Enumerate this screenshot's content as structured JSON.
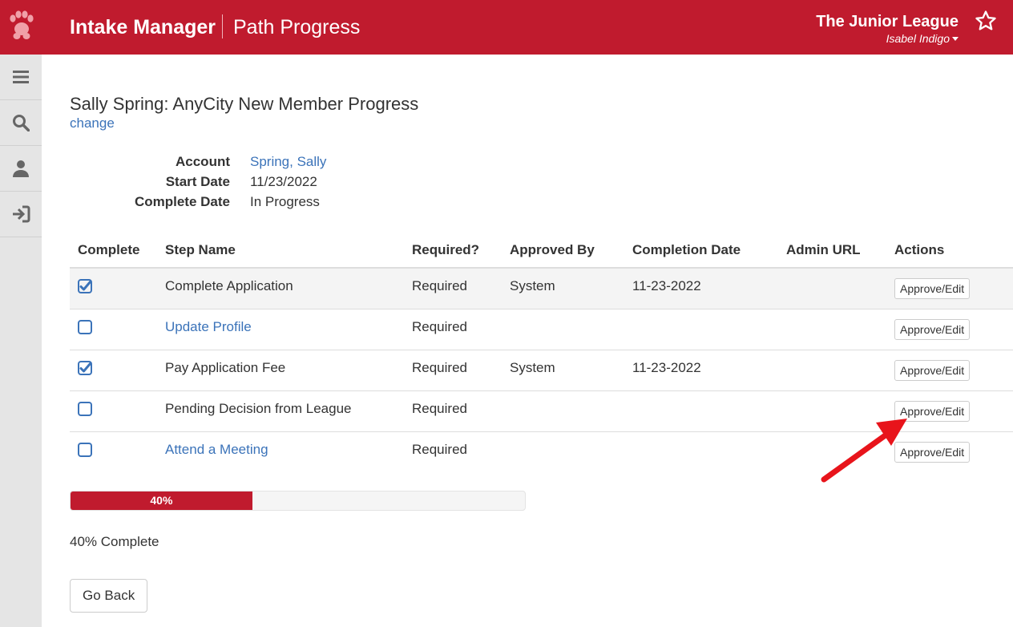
{
  "header": {
    "app_name": "Intake Manager",
    "section": "Path Progress",
    "organization": "The Junior League",
    "user_name": "Isabel Indigo"
  },
  "sidebar": {
    "items": [
      {
        "icon": "menu-icon"
      },
      {
        "icon": "search-icon"
      },
      {
        "icon": "user-icon"
      },
      {
        "icon": "sign-in-icon"
      }
    ]
  },
  "member": {
    "title": "Sally Spring: AnyCity New Member Progress",
    "change_link": "change",
    "info": {
      "account_label": "Account",
      "account_value": "Spring, Sally",
      "start_label": "Start Date",
      "start_value": "11/23/2022",
      "complete_label": "Complete Date",
      "complete_value": "In Progress"
    }
  },
  "table": {
    "headers": [
      "Complete",
      "Step Name",
      "Required?",
      "Approved By",
      "Completion Date",
      "Admin URL",
      "Actions"
    ],
    "rows": [
      {
        "complete": true,
        "step": "Complete Application",
        "is_link": false,
        "required": "Required",
        "approved_by": "System",
        "completion_date": "11-23-2022",
        "admin_url": "",
        "action": "Approve/Edit"
      },
      {
        "complete": false,
        "step": "Update Profile",
        "is_link": true,
        "required": "Required",
        "approved_by": "",
        "completion_date": "",
        "admin_url": "",
        "action": "Approve/Edit"
      },
      {
        "complete": true,
        "step": "Pay Application Fee",
        "is_link": false,
        "required": "Required",
        "approved_by": "System",
        "completion_date": "11-23-2022",
        "admin_url": "",
        "action": "Approve/Edit"
      },
      {
        "complete": false,
        "step": "Pending Decision from League",
        "is_link": false,
        "required": "Required",
        "approved_by": "",
        "completion_date": "",
        "admin_url": "",
        "action": "Approve/Edit"
      },
      {
        "complete": false,
        "step": "Attend a Meeting",
        "is_link": true,
        "required": "Required",
        "approved_by": "",
        "completion_date": "",
        "admin_url": "",
        "action": "Approve/Edit"
      }
    ]
  },
  "progress": {
    "percent": 40,
    "bar_label": "40%",
    "complete_text": "40% Complete"
  },
  "go_back_label": "Go Back",
  "colors": {
    "brand": "#c01b2e",
    "link": "#3b73b9",
    "checkbox": "#3b73b9",
    "annotation_arrow": "#e8141b"
  }
}
